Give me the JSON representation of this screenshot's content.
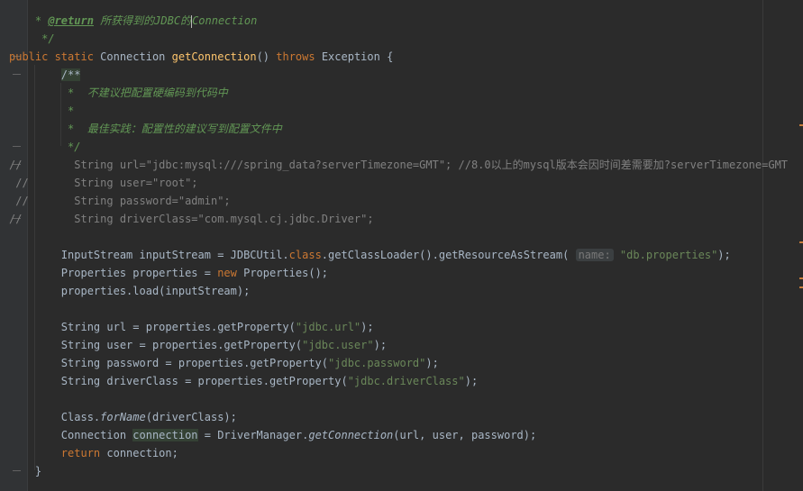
{
  "editor": {
    "lines": [
      {
        "id": "l1",
        "parts": [
          [
            "doc",
            "    * "
          ],
          [
            "doc-tag",
            "@return"
          ],
          [
            "doc",
            " 所获得到的JDBC的"
          ],
          [
            "caret",
            ""
          ],
          [
            "doc",
            "Connection"
          ]
        ]
      },
      {
        "id": "l2",
        "parts": [
          [
            "doc",
            "     */"
          ]
        ]
      },
      {
        "id": "l3",
        "parts": [
          [
            "kw",
            "public static "
          ],
          [
            "",
            "Connection "
          ],
          [
            "fn",
            "getConnection"
          ],
          [
            "",
            "() "
          ],
          [
            "kw",
            "throws "
          ],
          [
            "",
            "Exception {"
          ]
        ]
      },
      {
        "id": "l4",
        "parts": [
          [
            "pad",
            "        "
          ],
          [
            "hl-doc",
            "/**"
          ]
        ]
      },
      {
        "id": "l5",
        "parts": [
          [
            "doc",
            "         *  不建议把配置硬编码到代码中"
          ]
        ]
      },
      {
        "id": "l6",
        "parts": [
          [
            "doc",
            "         *"
          ]
        ]
      },
      {
        "id": "l7",
        "parts": [
          [
            "doc",
            "         *  最佳实践：配置性的建议写到配置文件中"
          ]
        ]
      },
      {
        "id": "l8",
        "parts": [
          [
            "doc",
            "         */"
          ]
        ]
      },
      {
        "id": "l9",
        "parts": [
          [
            "cmt",
            "//        String url=\"jdbc:mysql:///spring_data?serverTimezone=GMT\"; //8.0以上的mysql版本会因时间差需要加?serverTimezone=GMT"
          ]
        ]
      },
      {
        "id": "l10",
        "parts": [
          [
            "cmt",
            " //       String user=\"root\";"
          ]
        ]
      },
      {
        "id": "l11",
        "parts": [
          [
            "cmt",
            " //       String password=\"admin\";"
          ]
        ]
      },
      {
        "id": "l12",
        "parts": [
          [
            "cmt",
            "//        String driverClass=\"com.mysql.cj.jdbc.Driver\";"
          ]
        ]
      },
      {
        "id": "l13",
        "parts": [
          [
            "",
            ""
          ]
        ]
      },
      {
        "id": "l14",
        "parts": [
          [
            "",
            "        InputStream inputStream = JDBCUtil."
          ],
          [
            "kw",
            "class"
          ],
          [
            "",
            ".getClassLoader().getResourceAsStream( "
          ],
          [
            "hint",
            "name:"
          ],
          [
            "",
            " "
          ],
          [
            "str",
            "\"db.properties\""
          ],
          [
            "",
            ");"
          ]
        ]
      },
      {
        "id": "l15",
        "parts": [
          [
            "",
            "        Properties properties = "
          ],
          [
            "kw",
            "new "
          ],
          [
            "",
            "Properties();"
          ]
        ]
      },
      {
        "id": "l16",
        "parts": [
          [
            "",
            "        properties.load(inputStream);"
          ]
        ]
      },
      {
        "id": "l17",
        "parts": [
          [
            "",
            ""
          ]
        ]
      },
      {
        "id": "l18",
        "parts": [
          [
            "",
            "        String url = properties.getProperty("
          ],
          [
            "str",
            "\"jdbc.url\""
          ],
          [
            "",
            ");"
          ]
        ]
      },
      {
        "id": "l19",
        "parts": [
          [
            "",
            "        String user = properties.getProperty("
          ],
          [
            "str",
            "\"jdbc.user\""
          ],
          [
            "",
            ");"
          ]
        ]
      },
      {
        "id": "l20",
        "parts": [
          [
            "",
            "        String password = properties.getProperty("
          ],
          [
            "str",
            "\"jdbc.password\""
          ],
          [
            "",
            ");"
          ]
        ]
      },
      {
        "id": "l21",
        "parts": [
          [
            "",
            "        String driverClass = properties.getProperty("
          ],
          [
            "str",
            "\"jdbc.driverClass\""
          ],
          [
            "",
            ");"
          ]
        ]
      },
      {
        "id": "l22",
        "parts": [
          [
            "",
            ""
          ]
        ]
      },
      {
        "id": "l23",
        "parts": [
          [
            "",
            "        Class."
          ],
          [
            "ital",
            "forName"
          ],
          [
            "",
            "(driverClass);"
          ]
        ]
      },
      {
        "id": "l24",
        "parts": [
          [
            "",
            "        Connection "
          ],
          [
            "hl-var",
            "connection"
          ],
          [
            "",
            " = DriverManager."
          ],
          [
            "ital",
            "getConnection"
          ],
          [
            "",
            "(url, user, password);"
          ]
        ]
      },
      {
        "id": "l25",
        "parts": [
          [
            "kw",
            "        return "
          ],
          [
            "",
            "connection;"
          ]
        ]
      },
      {
        "id": "l26",
        "parts": [
          [
            "",
            "    }"
          ]
        ]
      }
    ]
  }
}
